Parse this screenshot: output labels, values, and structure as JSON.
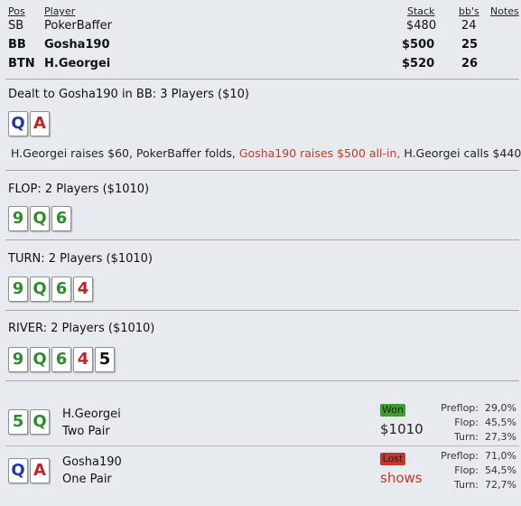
{
  "table": {
    "headers": {
      "pos": "Pos",
      "player": "Player",
      "stack": "Stack",
      "bbs": "bb's",
      "notes": "Notes"
    },
    "rows": [
      {
        "pos": "SB",
        "player": "PokerBaffer",
        "stack": "$480",
        "bbs": "24"
      },
      {
        "pos": "BB",
        "player": "Gosha190",
        "stack": "$500",
        "bbs": "25"
      },
      {
        "pos": "BTN",
        "player": "H.Georgei",
        "stack": "$520",
        "bbs": "26"
      }
    ]
  },
  "preflop": {
    "title": "Dealt to Gosha190 in BB: 3 Players ($10)",
    "cards": [
      {
        "rank": "Q",
        "color": "#1a3aa8"
      },
      {
        "rank": "A",
        "color": "#b8262b"
      }
    ],
    "action_1": "H.Georgei raises $60, PokerBaffer folds, ",
    "action_2": "Gosha190 raises $500 all-in,",
    "action_3": " H.Georgei calls $440"
  },
  "flop": {
    "title": "FLOP: 2 Players ($1010)",
    "cards": [
      {
        "rank": "9",
        "color": "#2e8b2e"
      },
      {
        "rank": "Q",
        "color": "#2e8b2e"
      },
      {
        "rank": "6",
        "color": "#2e8b2e"
      }
    ]
  },
  "turn": {
    "title": "TURN: 2 Players ($1010)",
    "cards": [
      {
        "rank": "9",
        "color": "#2e8b2e"
      },
      {
        "rank": "Q",
        "color": "#2e8b2e"
      },
      {
        "rank": "6",
        "color": "#2e8b2e"
      },
      {
        "rank": "4",
        "color": "#b8262b"
      }
    ]
  },
  "river": {
    "title": "RIVER: 2 Players ($1010)",
    "cards": [
      {
        "rank": "9",
        "color": "#2e8b2e"
      },
      {
        "rank": "Q",
        "color": "#2e8b2e"
      },
      {
        "rank": "6",
        "color": "#2e8b2e"
      },
      {
        "rank": "4",
        "color": "#b8262b"
      },
      {
        "rank": "5",
        "color": "#111111"
      }
    ]
  },
  "showdown": [
    {
      "name": "H.Georgei",
      "hand": "Two Pair",
      "cards": [
        {
          "rank": "5",
          "color": "#2e8b2e"
        },
        {
          "rank": "Q",
          "color": "#2e8b2e"
        }
      ],
      "badge": "Won",
      "badge_color": "#3d9e2c",
      "result": "$1010",
      "result_color": "#222222",
      "equity": [
        {
          "label": "Preflop:",
          "value": "29,0%"
        },
        {
          "label": "Flop:",
          "value": "45,5%"
        },
        {
          "label": "Turn:",
          "value": "27,3%"
        }
      ]
    },
    {
      "name": "Gosha190",
      "hand": "One Pair",
      "cards": [
        {
          "rank": "Q",
          "color": "#1a3aa8"
        },
        {
          "rank": "A",
          "color": "#b8262b"
        }
      ],
      "badge": "Lost",
      "badge_color": "#c0392b",
      "result": "shows",
      "result_color": "#c0392b",
      "equity": [
        {
          "label": "Preflop:",
          "value": "71,0%"
        },
        {
          "label": "Flop:",
          "value": "54,5%"
        },
        {
          "label": "Turn:",
          "value": "72,7%"
        }
      ]
    }
  ]
}
